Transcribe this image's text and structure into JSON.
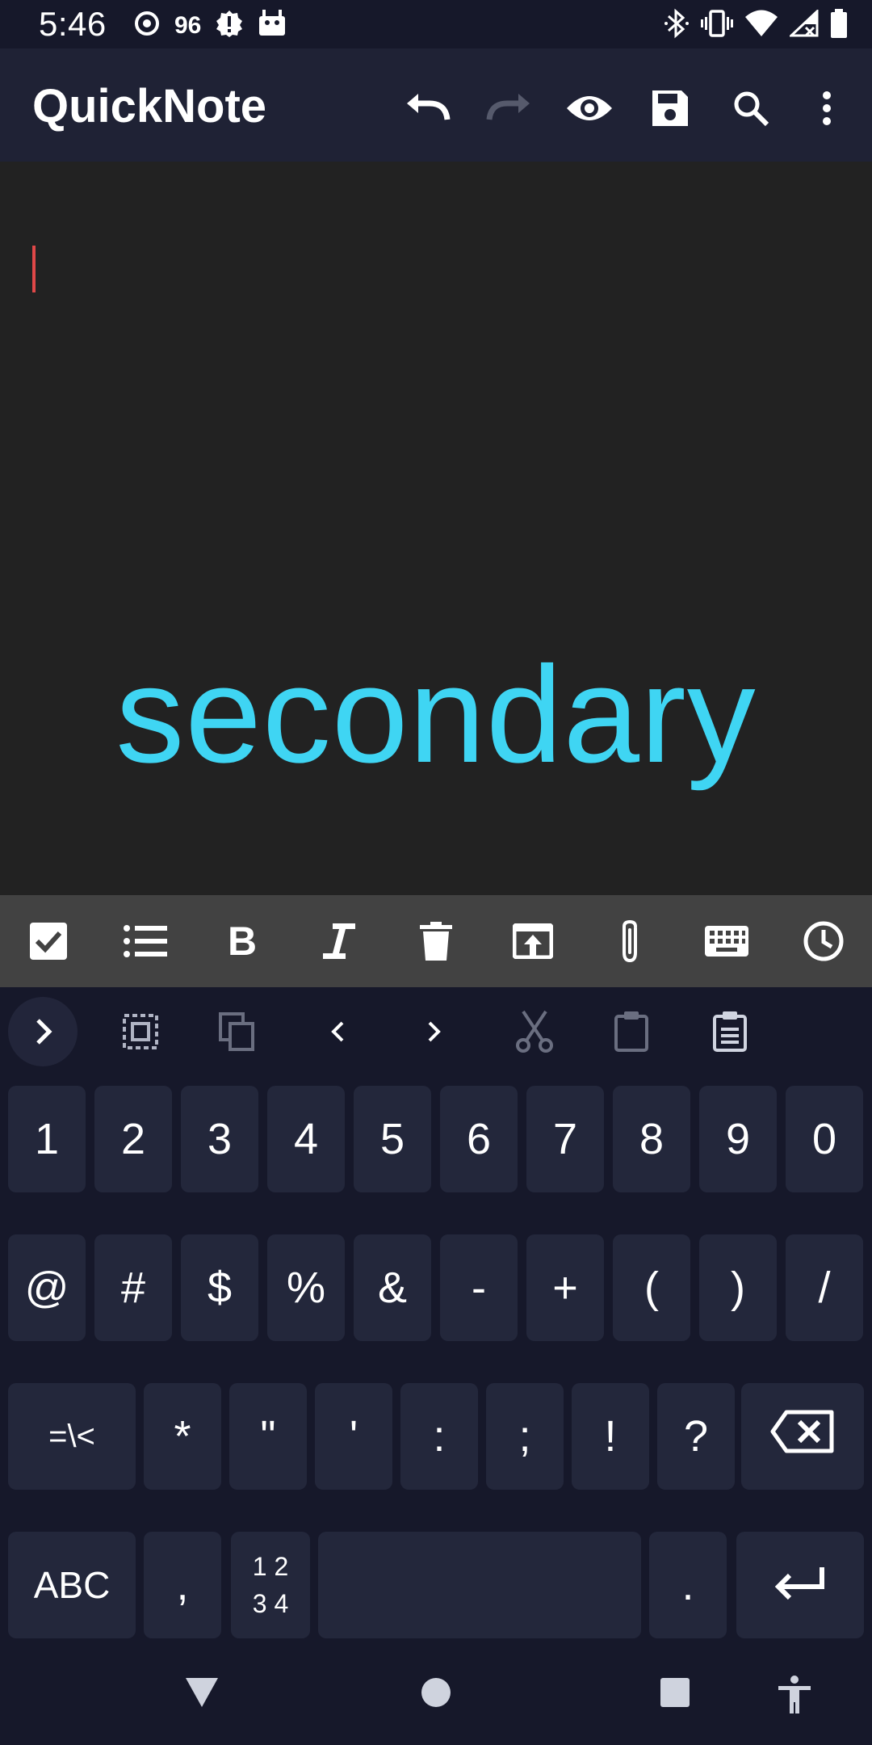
{
  "status_bar": {
    "time": "5:46",
    "notification_count": "96",
    "icons": [
      "moon-sync-icon",
      "alert-icon",
      "android-icon",
      "bluetooth-icon",
      "vibrate-icon",
      "wifi-icon",
      "no-signal-icon",
      "battery-icon"
    ]
  },
  "app_bar": {
    "title": "QuickNote",
    "actions": [
      "undo-icon",
      "redo-icon",
      "preview-eye-icon",
      "save-icon",
      "search-icon",
      "more-vert-icon"
    ]
  },
  "editor": {
    "content": "secondary",
    "cursor_color": "#e04848",
    "text_color": "#3fd5f3"
  },
  "format_toolbar": {
    "icons": [
      "checkbox-icon",
      "bullet-list-icon",
      "bold-icon",
      "italic-icon",
      "delete-icon",
      "open-in-icon",
      "attachment-icon",
      "keyboard-icon",
      "clock-icon"
    ]
  },
  "keyboard_toolbar": {
    "icons": [
      "expand-arrow-icon",
      "select-all-icon",
      "copy-icon",
      "cursor-left-icon",
      "cursor-right-icon",
      "cut-icon",
      "paste-icon",
      "clipboard-icon"
    ]
  },
  "keyboard": {
    "row1": [
      "1",
      "2",
      "3",
      "4",
      "5",
      "6",
      "7",
      "8",
      "9",
      "0"
    ],
    "row2": [
      "@",
      "#",
      "$",
      "%",
      "&",
      "-",
      "+",
      "(",
      ")",
      "/"
    ],
    "row3": [
      "=\\<",
      "*",
      "\"",
      "'",
      ":",
      ";",
      "!",
      "?"
    ],
    "row4": {
      "abc": "ABC",
      "comma": ",",
      "numpad_line1": "1 2",
      "numpad_line2": "3 4",
      "period": "."
    }
  },
  "nav_bar": {
    "icons": [
      "back-icon",
      "home-icon",
      "recents-icon",
      "accessibility-icon"
    ]
  }
}
